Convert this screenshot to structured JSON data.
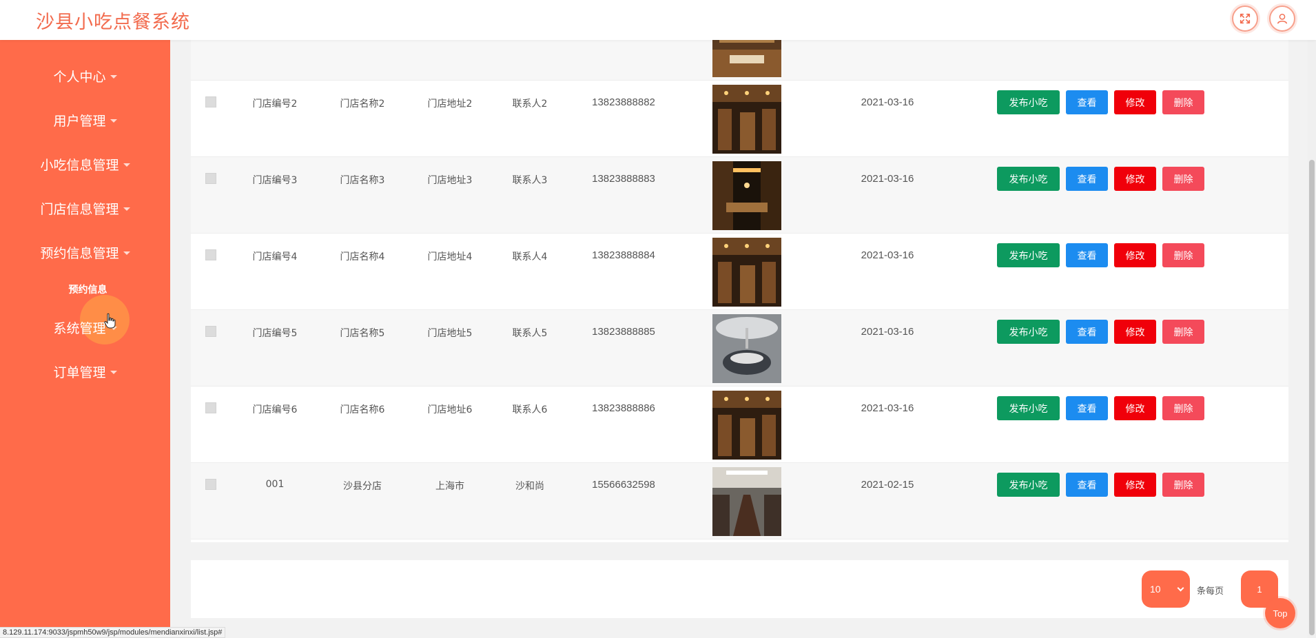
{
  "app": {
    "title": "沙县小吃点餐系统"
  },
  "header": {
    "icons": [
      "fullscreen-icon",
      "user-icon"
    ]
  },
  "sidebar": {
    "items": [
      {
        "label": "个人中心"
      },
      {
        "label": "用户管理"
      },
      {
        "label": "小吃信息管理"
      },
      {
        "label": "门店信息管理"
      },
      {
        "label": "预约信息管理"
      },
      {
        "label": "系统管理"
      },
      {
        "label": "订单管理"
      }
    ],
    "submenu": {
      "label": "预约信息"
    }
  },
  "table": {
    "actions": {
      "publish": "发布小吃",
      "view": "查看",
      "edit": "修改",
      "delete": "删除"
    },
    "rows": [
      {
        "code": "门店编号2",
        "name": "门店名称2",
        "address": "门店地址2",
        "contact": "联系人2",
        "phone": "13823888882",
        "date": "2021-03-16"
      },
      {
        "code": "门店编号3",
        "name": "门店名称3",
        "address": "门店地址3",
        "contact": "联系人3",
        "phone": "13823888883",
        "date": "2021-03-16"
      },
      {
        "code": "门店编号4",
        "name": "门店名称4",
        "address": "门店地址4",
        "contact": "联系人4",
        "phone": "13823888884",
        "date": "2021-03-16"
      },
      {
        "code": "门店编号5",
        "name": "门店名称5",
        "address": "门店地址5",
        "contact": "联系人5",
        "phone": "13823888885",
        "date": "2021-03-16"
      },
      {
        "code": "门店编号6",
        "name": "门店名称6",
        "address": "门店地址6",
        "contact": "联系人6",
        "phone": "13823888886",
        "date": "2021-03-16"
      },
      {
        "code": "001",
        "name": "沙县分店",
        "address": "上海市",
        "contact": "沙和尚",
        "phone": "15566632598",
        "date": "2021-02-15"
      }
    ]
  },
  "pagination": {
    "page_size": "10",
    "page_size_label": "条每页",
    "current_page": "1"
  },
  "top_button": {
    "label": "Top"
  },
  "status_bar": {
    "url": "8.129.11.174:9033/jspmh50w9/jsp/modules/mendianxinxi/list.jsp#"
  }
}
